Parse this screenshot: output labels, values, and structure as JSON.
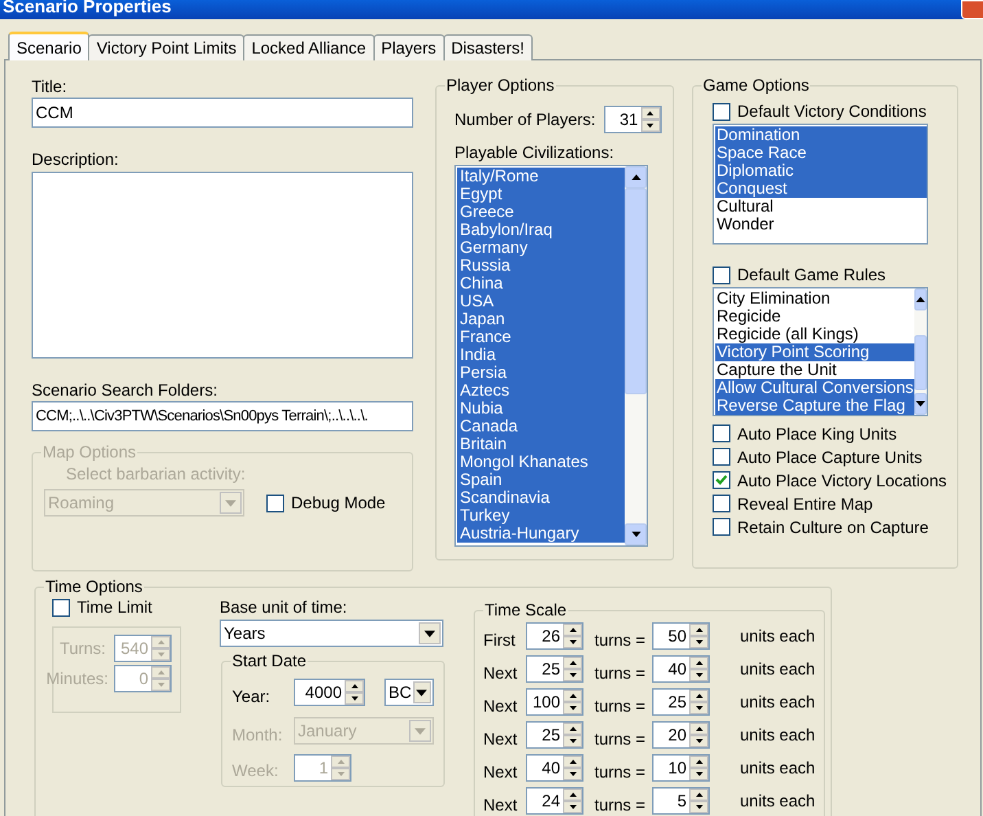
{
  "window": {
    "title": "Scenario Properties"
  },
  "tabs": [
    {
      "label": "Scenario",
      "selected": true
    },
    {
      "label": "Victory Point Limits",
      "selected": false
    },
    {
      "label": "Locked Alliance",
      "selected": false
    },
    {
      "label": "Players",
      "selected": false
    },
    {
      "label": "Disasters!",
      "selected": false
    }
  ],
  "title_field": {
    "label": "Title:",
    "value": "CCM"
  },
  "description": {
    "label": "Description:"
  },
  "search_folders": {
    "label": "Scenario Search Folders:",
    "value": "CCM;..\\..\\Civ3PTW\\Scenarios\\Sn00pys Terrain\\;..\\..\\..\\."
  },
  "map_options": {
    "title": "Map Options",
    "disabled": true,
    "barbarian_label": "Select barbarian activity:",
    "barbarian_value": "Roaming",
    "debug_mode": {
      "label": "Debug Mode",
      "checked": false
    }
  },
  "player_options": {
    "title": "Player Options",
    "players_label": "Number of Players:",
    "players_value": "31",
    "civs_label": "Playable Civilizations:",
    "civilizations": [
      {
        "name": "Italy/Rome",
        "selected": true
      },
      {
        "name": "Egypt",
        "selected": true
      },
      {
        "name": "Greece",
        "selected": true
      },
      {
        "name": "Babylon/Iraq",
        "selected": true
      },
      {
        "name": "Germany",
        "selected": true
      },
      {
        "name": "Russia",
        "selected": true
      },
      {
        "name": "China",
        "selected": true
      },
      {
        "name": "USA",
        "selected": true
      },
      {
        "name": "Japan",
        "selected": true
      },
      {
        "name": "France",
        "selected": true
      },
      {
        "name": "India",
        "selected": true
      },
      {
        "name": "Persia",
        "selected": true
      },
      {
        "name": "Aztecs",
        "selected": true
      },
      {
        "name": "Nubia",
        "selected": true
      },
      {
        "name": "Canada",
        "selected": true
      },
      {
        "name": "Britain",
        "selected": true
      },
      {
        "name": "Mongol Khanates",
        "selected": true
      },
      {
        "name": "Spain",
        "selected": true
      },
      {
        "name": "Scandinavia",
        "selected": true
      },
      {
        "name": "Turkey",
        "selected": true
      },
      {
        "name": "Austria-Hungary",
        "selected": true
      }
    ]
  },
  "game_options": {
    "title": "Game Options",
    "default_victory": {
      "label": "Default Victory Conditions",
      "checked": false
    },
    "victory_conditions": [
      {
        "name": "Domination",
        "selected": true
      },
      {
        "name": "Space Race",
        "selected": true
      },
      {
        "name": "Diplomatic",
        "selected": true
      },
      {
        "name": "Conquest",
        "selected": true
      },
      {
        "name": "Cultural",
        "selected": false
      },
      {
        "name": "Wonder",
        "selected": false
      }
    ],
    "default_rules": {
      "label": "Default Game Rules",
      "checked": false
    },
    "game_rules": [
      {
        "name": "City Elimination",
        "selected": false
      },
      {
        "name": "Regicide",
        "selected": false
      },
      {
        "name": "Regicide (all Kings)",
        "selected": false
      },
      {
        "name": "Victory Point Scoring",
        "selected": true
      },
      {
        "name": "Capture the Unit",
        "selected": false
      },
      {
        "name": "Allow Cultural Conversions",
        "selected": true
      },
      {
        "name": "Reverse Capture the Flag",
        "selected": true
      }
    ],
    "options": [
      {
        "label": "Auto Place King Units",
        "checked": false
      },
      {
        "label": "Auto Place Capture Units",
        "checked": false
      },
      {
        "label": "Auto Place Victory Locations",
        "checked": true
      },
      {
        "label": "Reveal Entire Map",
        "checked": false
      },
      {
        "label": "Retain Culture on Capture",
        "checked": false
      }
    ]
  },
  "time_options": {
    "title": "Time Options",
    "time_limit": {
      "label": "Time Limit",
      "checked": false
    },
    "turns_label": "Turns:",
    "turns_value": "540",
    "minutes_label": "Minutes:",
    "minutes_value": "0",
    "base_unit_label": "Base unit of time:",
    "base_unit_value": "Years",
    "start_date": {
      "title": "Start Date",
      "year_label": "Year:",
      "year_value": "4000",
      "era": "BC",
      "month_label": "Month:",
      "month_value": "January",
      "month_disabled": true,
      "week_label": "Week:",
      "week_value": "1",
      "week_disabled": true
    }
  },
  "time_scale": {
    "title": "Time Scale",
    "rows": [
      {
        "label": "First",
        "turns": "26",
        "turns_label": "turns =",
        "units": "50",
        "units_label": "units each"
      },
      {
        "label": "Next",
        "turns": "25",
        "turns_label": "turns =",
        "units": "40",
        "units_label": "units each"
      },
      {
        "label": "Next",
        "turns": "100",
        "turns_label": "turns =",
        "units": "25",
        "units_label": "units each"
      },
      {
        "label": "Next",
        "turns": "25",
        "turns_label": "turns =",
        "units": "20",
        "units_label": "units each"
      },
      {
        "label": "Next",
        "turns": "40",
        "turns_label": "turns =",
        "units": "10",
        "units_label": "units each"
      },
      {
        "label": "Next",
        "turns": "24",
        "turns_label": "turns =",
        "units": "5",
        "units_label": "units each"
      }
    ]
  }
}
